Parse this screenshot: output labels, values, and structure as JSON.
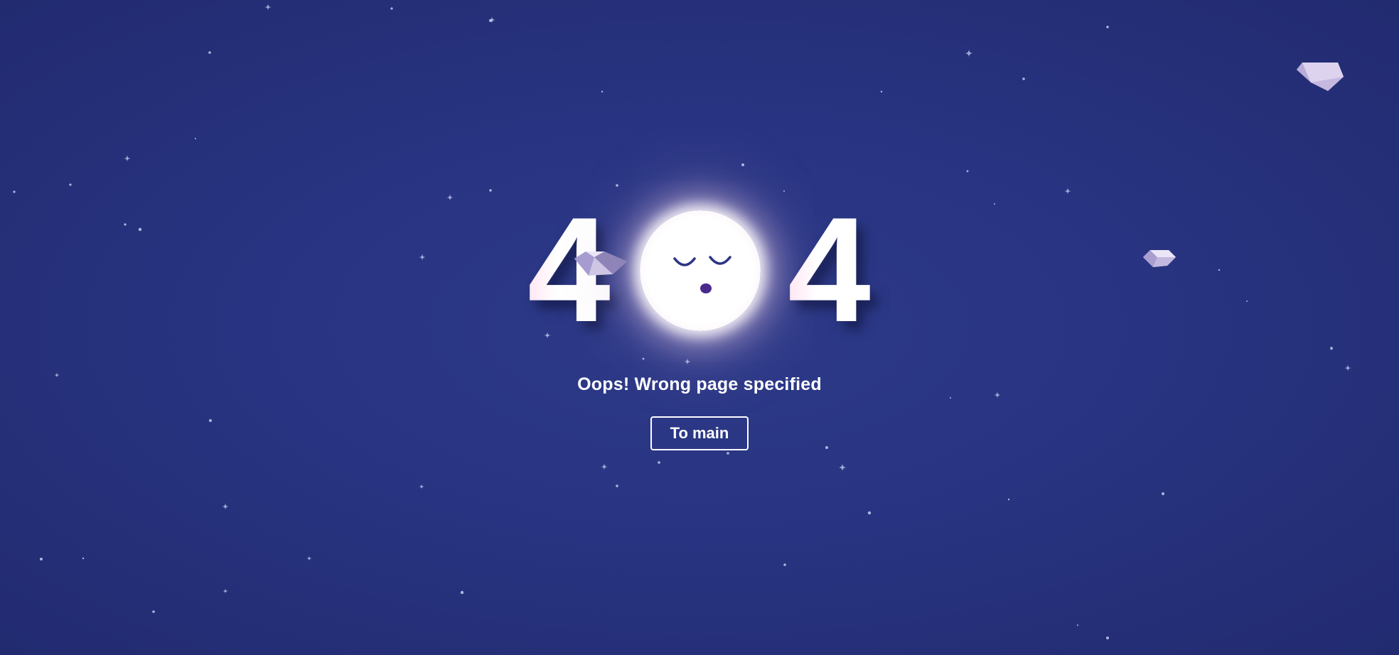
{
  "error": {
    "digit_left": "4",
    "digit_right": "4",
    "message": "Oops! Wrong page specified"
  },
  "actions": {
    "to_main_label": "To main"
  },
  "icons": {
    "moon": "sleeping-moon-icon",
    "crystal": "crystal-rock-icon",
    "star": "star-icon"
  },
  "colors": {
    "background": "#293583",
    "text": "#ffffff",
    "moon_eye": "#2c3583",
    "moon_mouth": "#4a2a8c",
    "crystal_light": "#dcd4ee",
    "crystal_dark": "#8f84b8"
  }
}
